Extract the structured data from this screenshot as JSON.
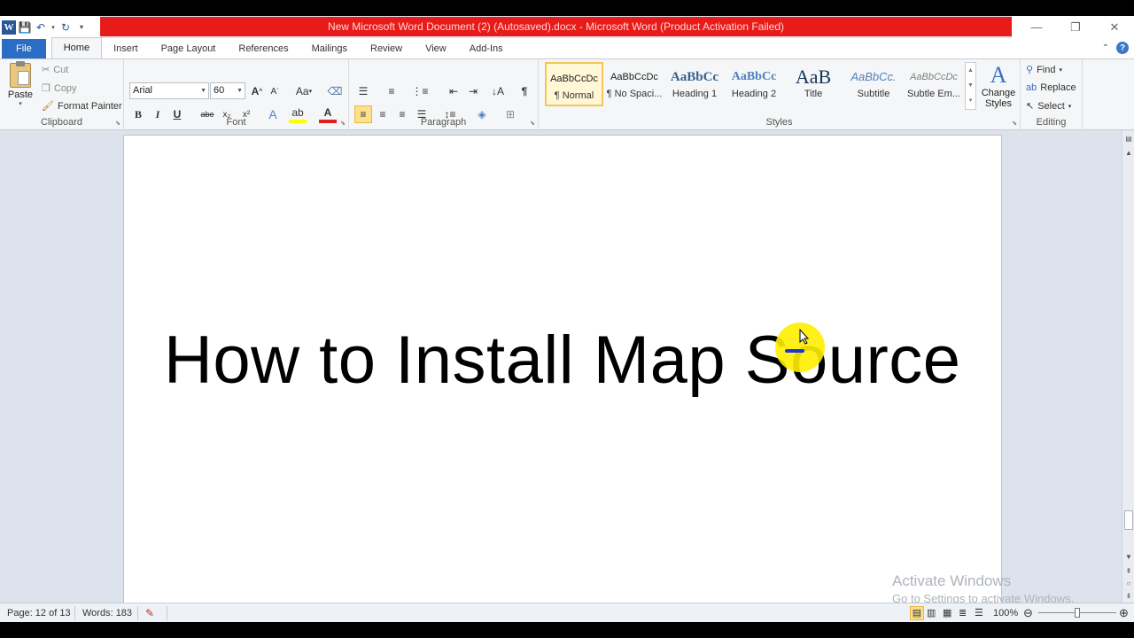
{
  "window": {
    "title": "New Microsoft Word Document (2) (Autosaved).docx  -  Microsoft Word (Product Activation Failed)",
    "controls": {
      "minimize": "—",
      "restore": "❐",
      "close": "✕"
    }
  },
  "tabs": [
    "File",
    "Home",
    "Insert",
    "Page Layout",
    "References",
    "Mailings",
    "Review",
    "View",
    "Add-Ins"
  ],
  "clipboard": {
    "paste": "Paste",
    "cut": "Cut",
    "copy": "Copy",
    "format_painter": "Format Painter",
    "label": "Clipboard"
  },
  "font": {
    "name": "Arial",
    "size": "60",
    "label": "Font",
    "bold": "B",
    "italic": "I",
    "underline": "U",
    "strike": "abe",
    "subscript": "x₂",
    "superscript": "x²"
  },
  "paragraph": {
    "label": "Paragraph",
    "pilcrow": "¶"
  },
  "styles": {
    "label": "Styles",
    "items": [
      {
        "preview": "AaBbCcDc",
        "name": "¶ Normal"
      },
      {
        "preview": "AaBbCcDc",
        "name": "¶ No Spaci..."
      },
      {
        "preview": "AaBbCc",
        "name": "Heading 1"
      },
      {
        "preview": "AaBbCc",
        "name": "Heading 2"
      },
      {
        "preview": "AaB",
        "name": "Title"
      },
      {
        "preview": "AaBbCc.",
        "name": "Subtitle"
      },
      {
        "preview": "AaBbCcDc",
        "name": "Subtle Em..."
      }
    ],
    "change_styles_1": "Change",
    "change_styles_2": "Styles"
  },
  "editing": {
    "find": "Find",
    "replace": "Replace",
    "select": "Select",
    "label": "Editing"
  },
  "document": {
    "heading": "How to Install Map Source"
  },
  "watermark": {
    "line1": "Activate Windows",
    "line2": "Go to Settings to activate Windows."
  },
  "status": {
    "page": "Page: 12 of 13",
    "words": "Words: 183",
    "zoom": "100%"
  }
}
